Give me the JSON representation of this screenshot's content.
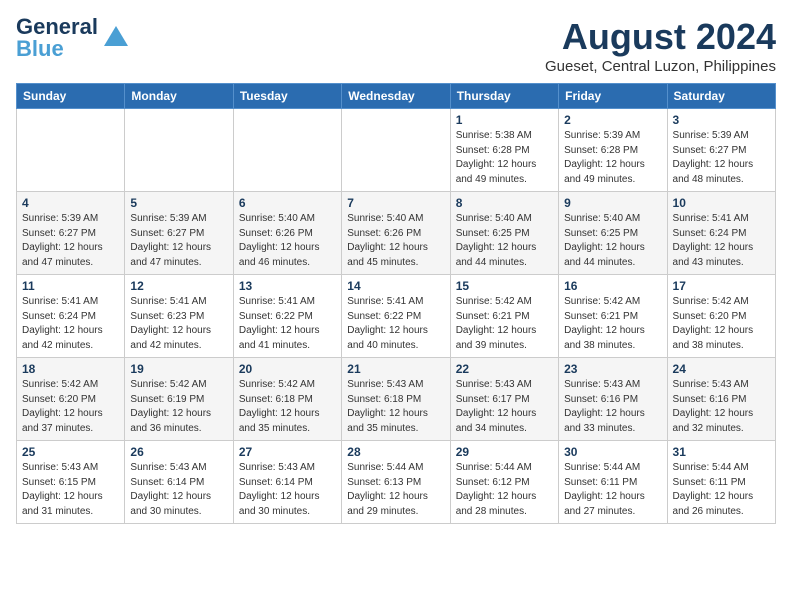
{
  "logo": {
    "line1": "General",
    "line2": "Blue"
  },
  "title": "August 2024",
  "subtitle": "Gueset, Central Luzon, Philippines",
  "days_of_week": [
    "Sunday",
    "Monday",
    "Tuesday",
    "Wednesday",
    "Thursday",
    "Friday",
    "Saturday"
  ],
  "weeks": [
    [
      {
        "day": "",
        "info": ""
      },
      {
        "day": "",
        "info": ""
      },
      {
        "day": "",
        "info": ""
      },
      {
        "day": "",
        "info": ""
      },
      {
        "day": "1",
        "info": "Sunrise: 5:38 AM\nSunset: 6:28 PM\nDaylight: 12 hours\nand 49 minutes."
      },
      {
        "day": "2",
        "info": "Sunrise: 5:39 AM\nSunset: 6:28 PM\nDaylight: 12 hours\nand 49 minutes."
      },
      {
        "day": "3",
        "info": "Sunrise: 5:39 AM\nSunset: 6:27 PM\nDaylight: 12 hours\nand 48 minutes."
      }
    ],
    [
      {
        "day": "4",
        "info": "Sunrise: 5:39 AM\nSunset: 6:27 PM\nDaylight: 12 hours\nand 47 minutes."
      },
      {
        "day": "5",
        "info": "Sunrise: 5:39 AM\nSunset: 6:27 PM\nDaylight: 12 hours\nand 47 minutes."
      },
      {
        "day": "6",
        "info": "Sunrise: 5:40 AM\nSunset: 6:26 PM\nDaylight: 12 hours\nand 46 minutes."
      },
      {
        "day": "7",
        "info": "Sunrise: 5:40 AM\nSunset: 6:26 PM\nDaylight: 12 hours\nand 45 minutes."
      },
      {
        "day": "8",
        "info": "Sunrise: 5:40 AM\nSunset: 6:25 PM\nDaylight: 12 hours\nand 44 minutes."
      },
      {
        "day": "9",
        "info": "Sunrise: 5:40 AM\nSunset: 6:25 PM\nDaylight: 12 hours\nand 44 minutes."
      },
      {
        "day": "10",
        "info": "Sunrise: 5:41 AM\nSunset: 6:24 PM\nDaylight: 12 hours\nand 43 minutes."
      }
    ],
    [
      {
        "day": "11",
        "info": "Sunrise: 5:41 AM\nSunset: 6:24 PM\nDaylight: 12 hours\nand 42 minutes."
      },
      {
        "day": "12",
        "info": "Sunrise: 5:41 AM\nSunset: 6:23 PM\nDaylight: 12 hours\nand 42 minutes."
      },
      {
        "day": "13",
        "info": "Sunrise: 5:41 AM\nSunset: 6:22 PM\nDaylight: 12 hours\nand 41 minutes."
      },
      {
        "day": "14",
        "info": "Sunrise: 5:41 AM\nSunset: 6:22 PM\nDaylight: 12 hours\nand 40 minutes."
      },
      {
        "day": "15",
        "info": "Sunrise: 5:42 AM\nSunset: 6:21 PM\nDaylight: 12 hours\nand 39 minutes."
      },
      {
        "day": "16",
        "info": "Sunrise: 5:42 AM\nSunset: 6:21 PM\nDaylight: 12 hours\nand 38 minutes."
      },
      {
        "day": "17",
        "info": "Sunrise: 5:42 AM\nSunset: 6:20 PM\nDaylight: 12 hours\nand 38 minutes."
      }
    ],
    [
      {
        "day": "18",
        "info": "Sunrise: 5:42 AM\nSunset: 6:20 PM\nDaylight: 12 hours\nand 37 minutes."
      },
      {
        "day": "19",
        "info": "Sunrise: 5:42 AM\nSunset: 6:19 PM\nDaylight: 12 hours\nand 36 minutes."
      },
      {
        "day": "20",
        "info": "Sunrise: 5:42 AM\nSunset: 6:18 PM\nDaylight: 12 hours\nand 35 minutes."
      },
      {
        "day": "21",
        "info": "Sunrise: 5:43 AM\nSunset: 6:18 PM\nDaylight: 12 hours\nand 35 minutes."
      },
      {
        "day": "22",
        "info": "Sunrise: 5:43 AM\nSunset: 6:17 PM\nDaylight: 12 hours\nand 34 minutes."
      },
      {
        "day": "23",
        "info": "Sunrise: 5:43 AM\nSunset: 6:16 PM\nDaylight: 12 hours\nand 33 minutes."
      },
      {
        "day": "24",
        "info": "Sunrise: 5:43 AM\nSunset: 6:16 PM\nDaylight: 12 hours\nand 32 minutes."
      }
    ],
    [
      {
        "day": "25",
        "info": "Sunrise: 5:43 AM\nSunset: 6:15 PM\nDaylight: 12 hours\nand 31 minutes."
      },
      {
        "day": "26",
        "info": "Sunrise: 5:43 AM\nSunset: 6:14 PM\nDaylight: 12 hours\nand 30 minutes."
      },
      {
        "day": "27",
        "info": "Sunrise: 5:43 AM\nSunset: 6:14 PM\nDaylight: 12 hours\nand 30 minutes."
      },
      {
        "day": "28",
        "info": "Sunrise: 5:44 AM\nSunset: 6:13 PM\nDaylight: 12 hours\nand 29 minutes."
      },
      {
        "day": "29",
        "info": "Sunrise: 5:44 AM\nSunset: 6:12 PM\nDaylight: 12 hours\nand 28 minutes."
      },
      {
        "day": "30",
        "info": "Sunrise: 5:44 AM\nSunset: 6:11 PM\nDaylight: 12 hours\nand 27 minutes."
      },
      {
        "day": "31",
        "info": "Sunrise: 5:44 AM\nSunset: 6:11 PM\nDaylight: 12 hours\nand 26 minutes."
      }
    ]
  ]
}
